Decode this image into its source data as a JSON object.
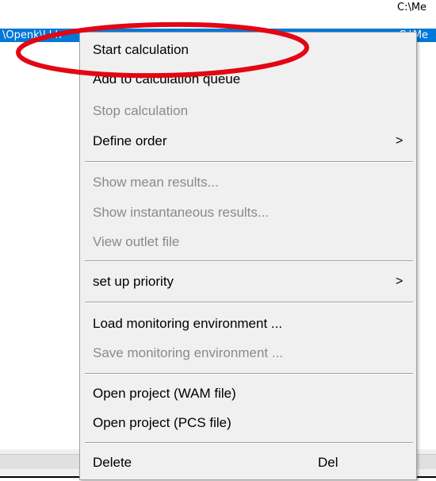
{
  "background": {
    "top_right_text": "C:\\Me",
    "selected_row": {
      "left_text": "\\Openk\\l l h",
      "right_text": "C:\\Me"
    }
  },
  "menu": {
    "items": [
      {
        "label": "Start calculation",
        "enabled": true
      },
      {
        "label": "Add to calculation queue",
        "enabled": true
      },
      {
        "label": "Stop calculation",
        "enabled": false
      },
      {
        "label": "Define order",
        "enabled": true,
        "submenu": true
      },
      {
        "label": "Show mean results...",
        "enabled": false
      },
      {
        "label": "Show instantaneous results...",
        "enabled": false
      },
      {
        "label": "View outlet file",
        "enabled": false
      },
      {
        "label": "set up priority",
        "enabled": true,
        "submenu": true
      },
      {
        "label": "Load monitoring environment ...",
        "enabled": true
      },
      {
        "label": "Save monitoring environment ...",
        "enabled": false
      },
      {
        "label": "Open project (WAM file)",
        "enabled": true
      },
      {
        "label": "Open project (PCS file)",
        "enabled": true
      },
      {
        "label": "Delete",
        "enabled": true,
        "shortcut": "Del"
      }
    ],
    "submenu_arrow": ">"
  },
  "annotation": {
    "color": "#e30613",
    "shape": "ellipse"
  },
  "colors": {
    "selection": "#0078d7",
    "menu_bg": "#f0f0f0",
    "disabled_text": "#8a8a8a"
  }
}
